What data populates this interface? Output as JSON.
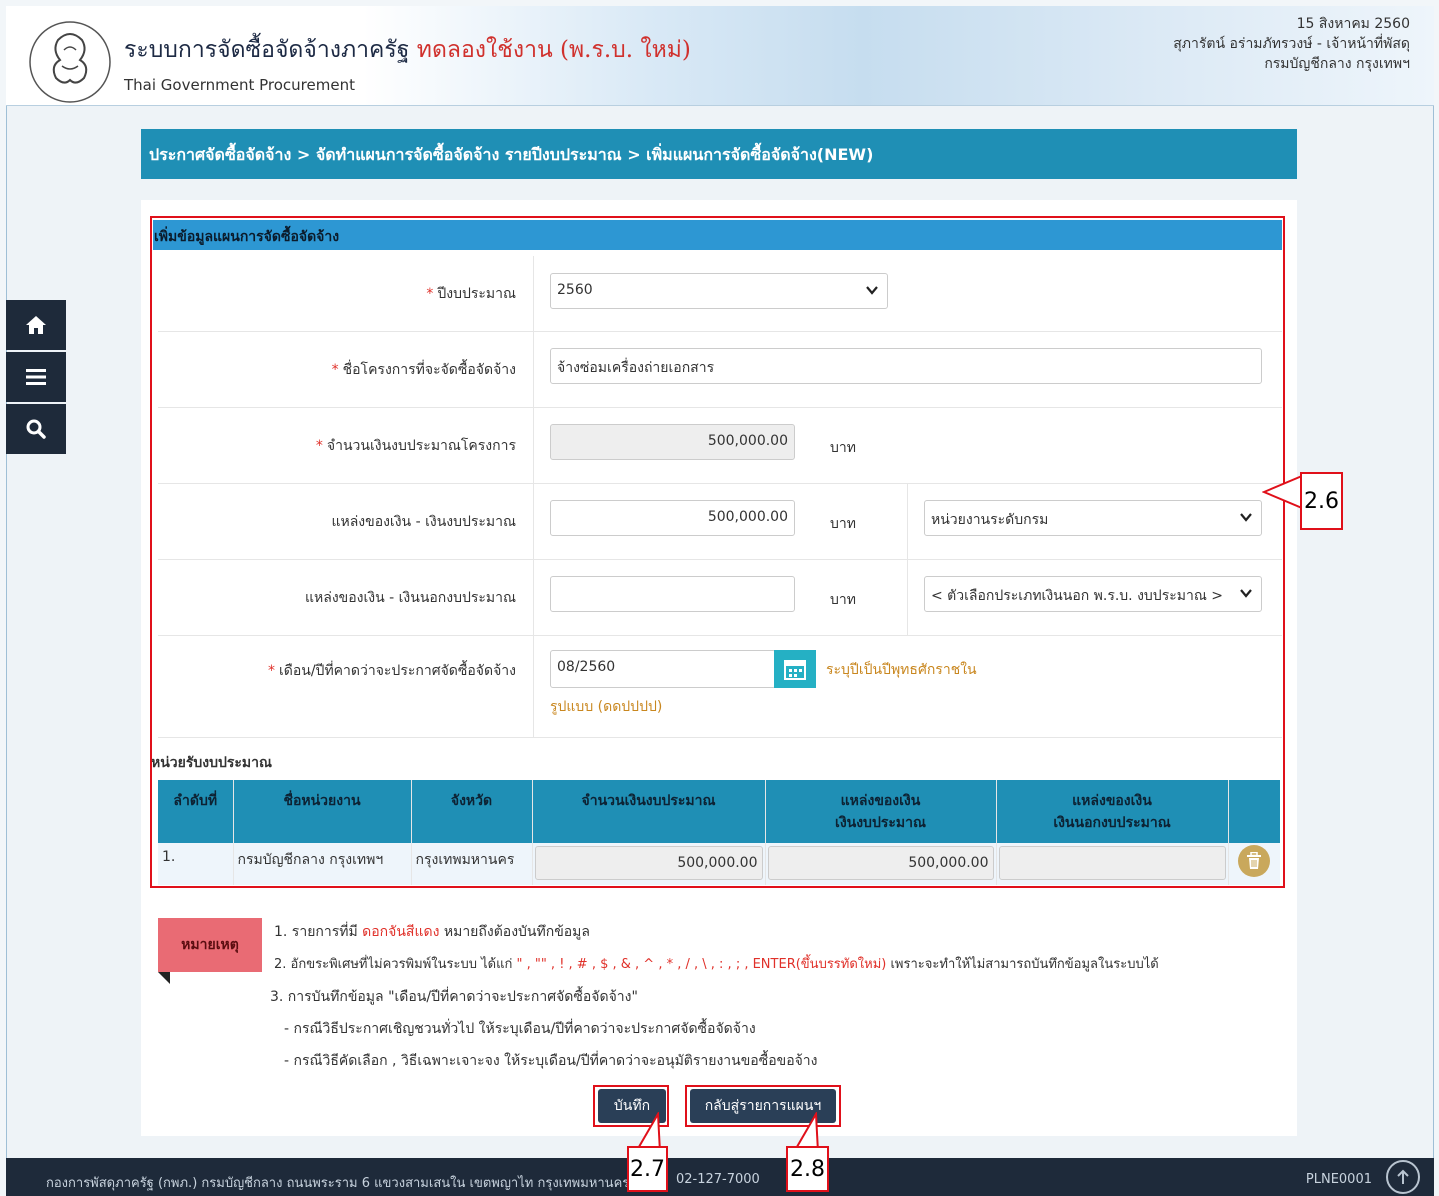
{
  "header": {
    "title": "ระบบการจัดซื้อจัดจ้างภาครัฐ",
    "trial": "ทดลองใช้งาน (พ.ร.บ. ใหม่)",
    "subtitle": "Thai Government Procurement",
    "date": "15 สิงหาคม 2560",
    "user": "สุภารัตน์ อร่ามภัทรวงษ์ - เจ้าหน้าที่พัสดุ",
    "org": "กรมบัญชีกลาง กรุงเทพฯ"
  },
  "sidenav": {
    "home_icon": "home-icon",
    "menu_icon": "menu-icon",
    "search_icon": "search-icon"
  },
  "breadcrumb": "ประกาศจัดซื้อจัดจ้าง > จัดทำแผนการจัดซื้อจัดจ้าง รายปีงบประมาณ > เพิ่มแผนการจัดซื้อจัดจ้าง(NEW)",
  "form": {
    "section_title": "เพิ่มข้อมูลแผนการจัดซื้อจัดจ้าง",
    "required_mark": "*",
    "fiscal_year_label": "ปีงบประมาณ",
    "fiscal_year_value": "2560",
    "project_name_label": "ชื่อโครงการที่จะจัดซื้อจัดจ้าง",
    "project_name_value": "จ้างซ่อมเครื่องถ่ายเอกสาร",
    "project_budget_label": "จำนวนเงินงบประมาณโครงการ",
    "project_budget_value": "500,000.00",
    "unit_baht": "บาท",
    "fund_budget_label": "แหล่งของเงิน - เงินงบประมาณ",
    "fund_budget_value": "500,000.00",
    "fund_budget_select": "หน่วยงานระดับกรม",
    "fund_offbudget_label": "แหล่งของเงิน - เงินนอกงบประมาณ",
    "fund_offbudget_value": "",
    "fund_offbudget_select": "< ตัวเลือกประเภทเงินนอก พ.ร.บ. งบประมาณ >",
    "announce_label": "เดือน/ปีที่คาดว่าจะประกาศจัดซื้อจัดจ้าง",
    "announce_value": "08/2560",
    "announce_hint": "ระบุปีเป็นปีพุทธศักราชใน",
    "announce_format": "รูปแบบ (ดดปปปป)"
  },
  "budget_table": {
    "title": "หน่วยรับงบประมาณ",
    "headers": {
      "no": "ลำดับที่",
      "agency": "ชื่อหน่วยงาน",
      "province": "จังหวัด",
      "amount": "จำนวนเงินงบประมาณ",
      "fund1_a": "แหล่งของเงิน",
      "fund1_b": "เงินงบประมาณ",
      "fund2_a": "แหล่งของเงิน",
      "fund2_b": "เงินนอกงบประมาณ"
    },
    "rows": [
      {
        "no": "1.",
        "agency": "กรมบัญชีกลาง กรุงเทพฯ",
        "province": "กรุงเทพมหานคร",
        "amount": "500,000.00",
        "fund1": "500,000.00",
        "fund2": ""
      }
    ]
  },
  "notes": {
    "tag": "หมายเหตุ",
    "line1_a": "1. รายการที่มี ",
    "line1_red": "ดอกจันสีแดง",
    "line1_b": " หมายถึงต้องบันทึกข้อมูล",
    "line2_a": "2. อักขระพิเศษที่ไม่ควรพิมพ์ในระบบ ได้แก่ ",
    "line2_red": "\" , \"\" , ! , # , $ , & , ^ , * , / , \\ , : , ; , ENTER(ขึ้นบรรทัดใหม่)",
    "line2_b": " เพราะจะทำให้ไม่สามารถบันทึกข้อมูลในระบบได้",
    "line3": "3. การบันทึกข้อมูล \"เดือน/ปีที่คาดว่าจะประกาศจัดซื้อจัดจ้าง\"",
    "line4": "- กรณีวิธีประกาศเชิญชวนทั่วไป ให้ระบุเดือน/ปีที่คาดว่าจะประกาศจัดซื้อจัดจ้าง",
    "line5": "- กรณีวิธีคัดเลือก , วิธีเฉพาะเจาะจง ให้ระบุเดือน/ปีที่คาดว่าจะอนุมัติรายงานขอซื้อขอจ้าง"
  },
  "buttons": {
    "save": "บันทึก",
    "back": "กลับสู่รายการแผนฯ"
  },
  "callouts": {
    "c26": "2.6",
    "c27": "2.7",
    "c28": "2.8"
  },
  "footer": {
    "address": "กองการพัสดุภาครัฐ (กพภ.) กรมบัญชีกลาง ถนนพระราม 6 แขวงสามเสนใน เขตพญาไท กรุงเทพมหานคร 104",
    "phone": "02-127-7000",
    "code": "PLNE0001"
  },
  "colors": {
    "accent": "#1f8fb5",
    "section": "#2d97d3",
    "nav": "#1e2a3a",
    "annotation": "#e0101a"
  }
}
